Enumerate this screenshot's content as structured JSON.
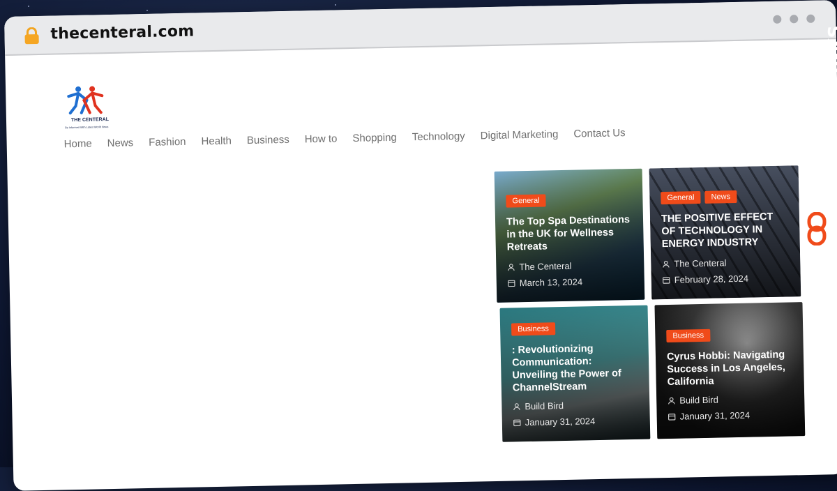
{
  "browser": {
    "url": "thecenteral.com",
    "lock_icon": "lock-icon",
    "window_controls": [
      "dot",
      "dot",
      "dot"
    ]
  },
  "site": {
    "logo_name": "THE CENTERAL",
    "logo_tagline": "Be Informed With Latest World News",
    "nav": [
      "Home",
      "News",
      "Fashion",
      "Health",
      "Business",
      "How to",
      "Shopping",
      "Technology",
      "Digital Marketing",
      "Contact Us"
    ]
  },
  "posts": [
    {
      "categories": [
        "General"
      ],
      "title": "The Top Spa Destinations in the UK for Wellness Retreats",
      "author": "The Centeral",
      "date": "March 13, 2024"
    },
    {
      "categories": [
        "General",
        "News"
      ],
      "title": "THE POSITIVE EFFECT OF TECHNOLOGY IN ENERGY INDUSTRY",
      "author": "The Centeral",
      "date": "February 28, 2024"
    },
    {
      "categories": [
        "Business"
      ],
      "title": ": Revolutionizing Communication: Unveiling the Power of ChannelStream",
      "author": "Build Bird",
      "date": "January 31, 2024"
    },
    {
      "categories": [
        "Business"
      ],
      "title": "Cyrus Hobbi: Navigating Success in Los Angeles, California",
      "author": "Build Bird",
      "date": "January 31, 2024"
    }
  ],
  "watermark": {
    "text": "GUESTPOSTLINKS"
  },
  "colors": {
    "badge": "#f04b1a",
    "nav_text": "#6f6f6f",
    "page_bg": "#0d1630"
  }
}
